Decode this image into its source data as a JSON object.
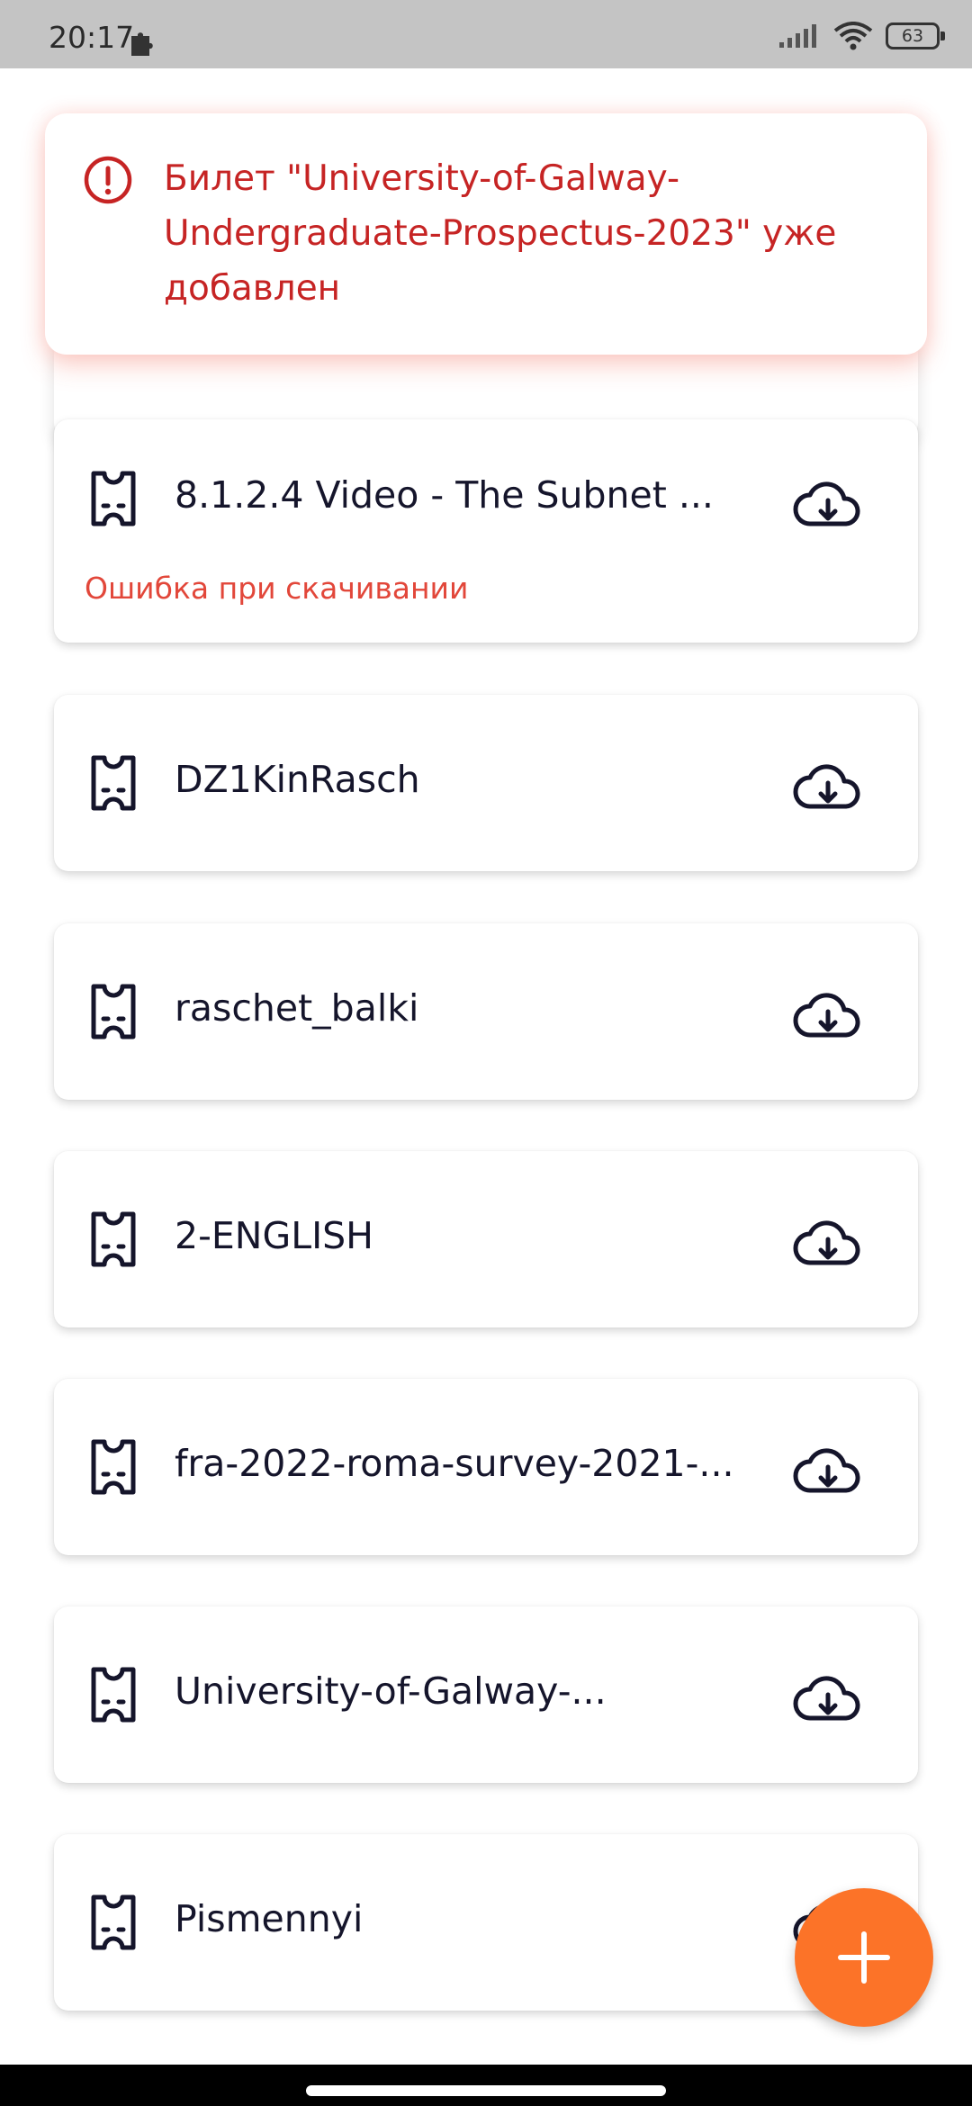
{
  "status_bar": {
    "time": "20:17",
    "battery": "63",
    "icons": [
      "puzzle-icon",
      "signal-icon",
      "wifi-icon",
      "battery-icon"
    ]
  },
  "toast": {
    "message": "Билет \"University-of-Galway-Undergraduate-Prospectus-2023\" уже добавлен",
    "icon": "alert-circle-icon",
    "color": "#c62424"
  },
  "tickets": [
    {
      "title": "8.1.2.4 Video - The Subnet ...",
      "error": "Ошибка при скачивании"
    },
    {
      "title": "DZ1KinRasch"
    },
    {
      "title": "raschet_balki"
    },
    {
      "title": "2-ENGLISH"
    },
    {
      "title": "fra-2022-roma-survey-2021-..."
    },
    {
      "title": "University-of-Galway-..."
    },
    {
      "title": "Pismennyi"
    }
  ],
  "icons": {
    "ticket": "ticket-icon",
    "download": "cloud-download-icon",
    "fab": "plus-icon"
  },
  "colors": {
    "accent": "#fc7328",
    "error": "#e2473a",
    "text": "#15152b"
  }
}
